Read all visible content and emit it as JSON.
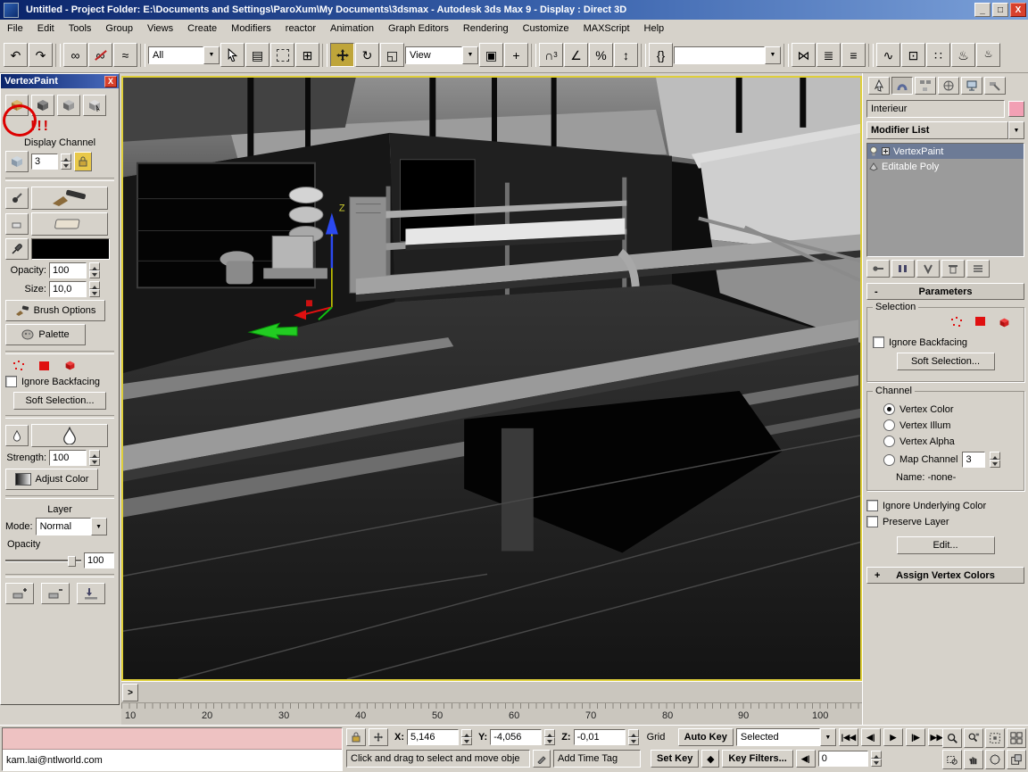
{
  "window": {
    "title": "Untitled     - Project Folder: E:\\Documents and Settings\\ParoXum\\My Documents\\3dsmax     - Autodesk 3ds Max 9     - Display : Direct 3D"
  },
  "menu": {
    "items": [
      "File",
      "Edit",
      "Tools",
      "Group",
      "Views",
      "Create",
      "Modifiers",
      "reactor",
      "Animation",
      "Graph Editors",
      "Rendering",
      "Customize",
      "MAXScript",
      "Help"
    ]
  },
  "toolbar": {
    "selection_filter": "All",
    "coordinate_system": "View",
    "named_selection": ""
  },
  "icons": {
    "min": "_",
    "max": "□",
    "close": "X",
    "undo": "↶",
    "redo": "↷",
    "link": "∞",
    "unlink": "∞",
    "bind": "≈",
    "select_by_name": "▤",
    "crossing": "⊞",
    "rotate": "↻",
    "scale": "◱",
    "pivot": "▣",
    "manipulate": "+",
    "snap": "∩",
    "snap3": "3",
    "angle": "∠",
    "percent": "%",
    "spinner_snap": "↕",
    "braces": "{}",
    "mirror": "⋈",
    "align": "≣",
    "layers": "≡",
    "curve": "∿",
    "schematic": "⊡",
    "material": "∷",
    "render": "♨",
    "dropdown": "▼",
    "time_start": "|◀◀",
    "time_prev": "◀|",
    "time_play": "▶",
    "time_next": "|▶",
    "time_end": "▶▶|",
    "key_mode": "◆",
    "mini_curve": ">"
  },
  "vertexpaint": {
    "title": "VertexPaint",
    "warning": "!!!",
    "display_channel_label": "Display Channel",
    "display_channel_value": "3",
    "opacity_label": "Opacity:",
    "opacity_value": "100",
    "size_label": "Size:",
    "size_value": "10,0",
    "brush_options_label": "Brush Options",
    "palette_label": "Palette",
    "ignore_backfacing_label": "Ignore Backfacing",
    "soft_selection_label": "Soft Selection...",
    "strength_label": "Strength:",
    "strength_value": "100",
    "adjust_color_label": "Adjust Color",
    "layer_section_label": "Layer",
    "mode_label": "Mode:",
    "mode_value": "Normal",
    "layer_opacity_label": "Opacity",
    "layer_opacity_value": "100",
    "paint_color": "#000000"
  },
  "command_panel": {
    "object_name": "Interieur",
    "object_color": "#f2a0b4",
    "modifier_list_label": "Modifier List",
    "stack_items": [
      {
        "label": "VertexPaint"
      },
      {
        "label": "Editable Poly"
      }
    ],
    "parameters_state": "-",
    "parameters_rollout_label": "Parameters",
    "selection_group_label": "Selection",
    "ignore_backfacing_label": "Ignore Backfacing",
    "soft_selection_label": "Soft Selection...",
    "channel_group_label": "Channel",
    "radio_vertex_color": "Vertex Color",
    "radio_vertex_illum": "Vertex Illum",
    "radio_vertex_alpha": "Vertex Alpha",
    "radio_map_channel": "Map Channel",
    "map_channel_value": "3",
    "map_name_label": "Name: -none-",
    "ignore_underlying_label": "Ignore Underlying Color",
    "preserve_layer_label": "Preserve Layer",
    "edit_button_label": "Edit...",
    "assign_state": "+",
    "assign_rollout_label": "Assign Vertex Colors"
  },
  "trackbar": {
    "labels": [
      "10",
      "20",
      "30",
      "40",
      "50",
      "60",
      "70",
      "80",
      "90",
      "100"
    ]
  },
  "statusbar": {
    "listener_text": "kam.lai@ntlworld.com",
    "x_label": "X:",
    "x_value": "5,146",
    "y_label": "Y:",
    "y_value": "-4,056",
    "z_label": "Z:",
    "z_value": "-0,01",
    "grid_label": "Grid",
    "prompt": "Click and drag to select and move obje",
    "time_tag_label": "Add Time Tag",
    "auto_key_label": "Auto Key",
    "set_key_label": "Set Key",
    "selection_set_value": "Selected",
    "key_filters_label": "Key Filters...",
    "frame_value": "0"
  },
  "viewport": {
    "gizmo_z_label": "Z"
  }
}
